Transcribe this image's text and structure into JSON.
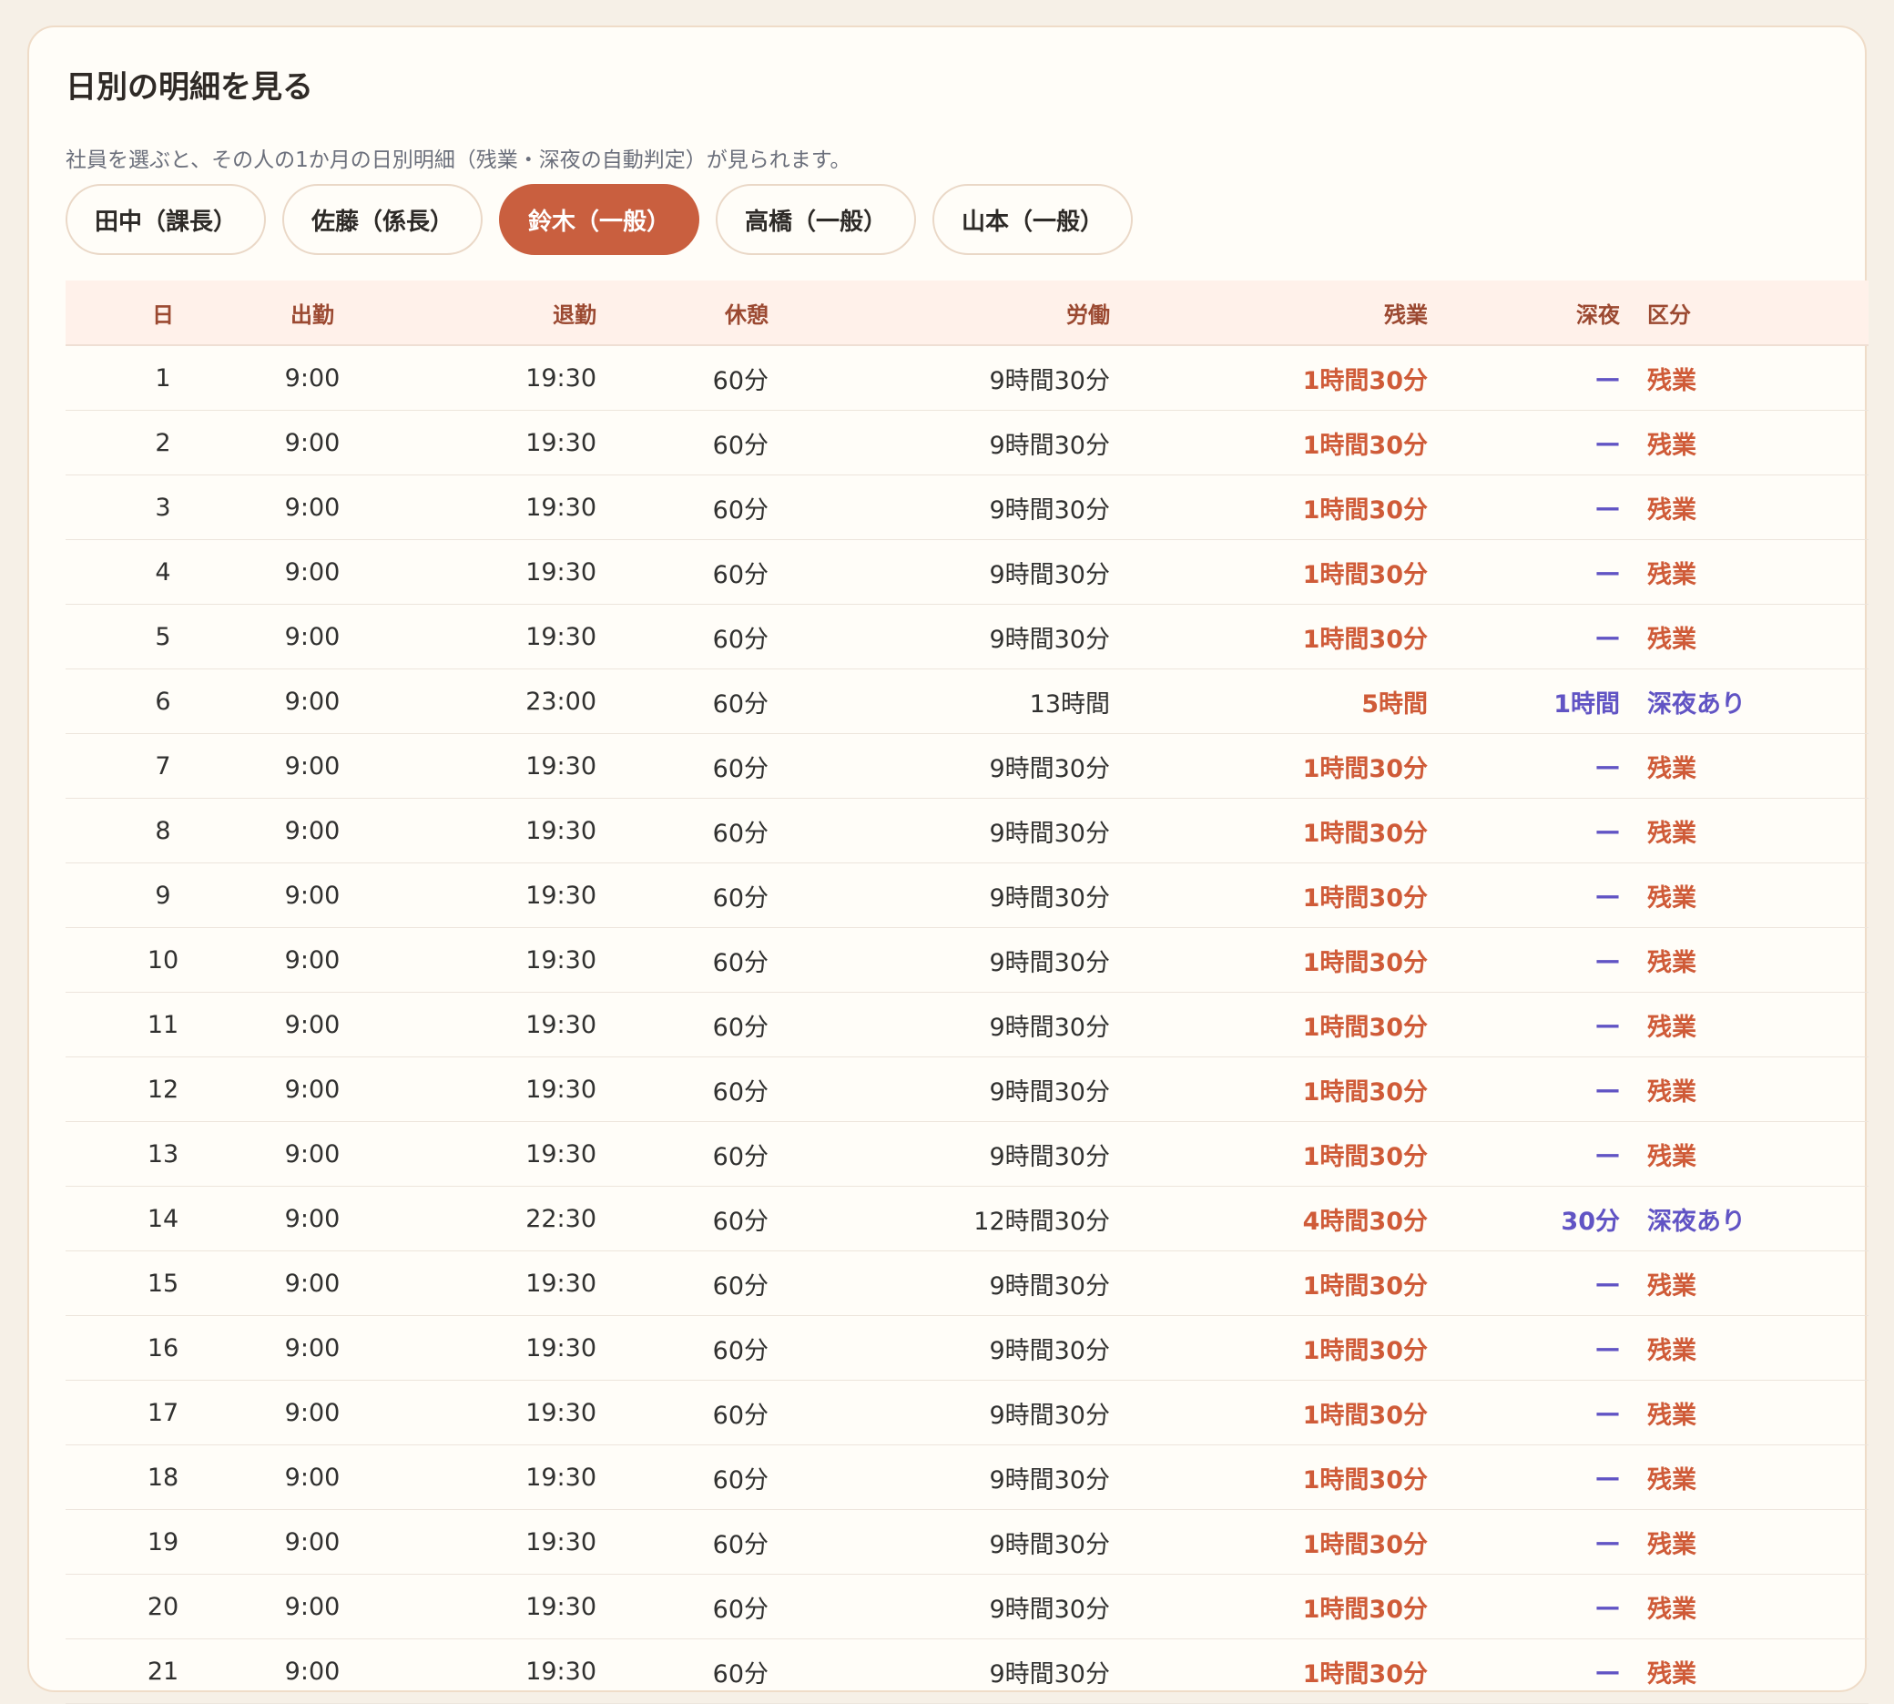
{
  "panel": {
    "title": "日別の明細を見る",
    "description": "社員を選ぶと、その人の1か月の日別明細（残業・深夜の自動判定）が見られます。"
  },
  "employees": [
    {
      "label": "田中（課長）",
      "selected": false
    },
    {
      "label": "佐藤（係長）",
      "selected": false
    },
    {
      "label": "鈴木（一般）",
      "selected": true
    },
    {
      "label": "高橋（一般）",
      "selected": false
    },
    {
      "label": "山本（一般）",
      "selected": false
    }
  ],
  "table": {
    "headers": [
      "日",
      "出勤",
      "退勤",
      "休憩",
      "労働",
      "残業",
      "深夜",
      "区分"
    ],
    "rows": [
      {
        "day": "1",
        "clock_in": "9:00",
        "clock_out": "19:30",
        "break": "60分",
        "work": "9時間30分",
        "overtime": "1時間30分",
        "night": "—",
        "category": "残業"
      },
      {
        "day": "2",
        "clock_in": "9:00",
        "clock_out": "19:30",
        "break": "60分",
        "work": "9時間30分",
        "overtime": "1時間30分",
        "night": "—",
        "category": "残業"
      },
      {
        "day": "3",
        "clock_in": "9:00",
        "clock_out": "19:30",
        "break": "60分",
        "work": "9時間30分",
        "overtime": "1時間30分",
        "night": "—",
        "category": "残業"
      },
      {
        "day": "4",
        "clock_in": "9:00",
        "clock_out": "19:30",
        "break": "60分",
        "work": "9時間30分",
        "overtime": "1時間30分",
        "night": "—",
        "category": "残業"
      },
      {
        "day": "5",
        "clock_in": "9:00",
        "clock_out": "19:30",
        "break": "60分",
        "work": "9時間30分",
        "overtime": "1時間30分",
        "night": "—",
        "category": "残業"
      },
      {
        "day": "6",
        "clock_in": "9:00",
        "clock_out": "23:00",
        "break": "60分",
        "work": "13時間",
        "overtime": "5時間",
        "night": "1時間",
        "category": "深夜あり"
      },
      {
        "day": "7",
        "clock_in": "9:00",
        "clock_out": "19:30",
        "break": "60分",
        "work": "9時間30分",
        "overtime": "1時間30分",
        "night": "—",
        "category": "残業"
      },
      {
        "day": "8",
        "clock_in": "9:00",
        "clock_out": "19:30",
        "break": "60分",
        "work": "9時間30分",
        "overtime": "1時間30分",
        "night": "—",
        "category": "残業"
      },
      {
        "day": "9",
        "clock_in": "9:00",
        "clock_out": "19:30",
        "break": "60分",
        "work": "9時間30分",
        "overtime": "1時間30分",
        "night": "—",
        "category": "残業"
      },
      {
        "day": "10",
        "clock_in": "9:00",
        "clock_out": "19:30",
        "break": "60分",
        "work": "9時間30分",
        "overtime": "1時間30分",
        "night": "—",
        "category": "残業"
      },
      {
        "day": "11",
        "clock_in": "9:00",
        "clock_out": "19:30",
        "break": "60分",
        "work": "9時間30分",
        "overtime": "1時間30分",
        "night": "—",
        "category": "残業"
      },
      {
        "day": "12",
        "clock_in": "9:00",
        "clock_out": "19:30",
        "break": "60分",
        "work": "9時間30分",
        "overtime": "1時間30分",
        "night": "—",
        "category": "残業"
      },
      {
        "day": "13",
        "clock_in": "9:00",
        "clock_out": "19:30",
        "break": "60分",
        "work": "9時間30分",
        "overtime": "1時間30分",
        "night": "—",
        "category": "残業"
      },
      {
        "day": "14",
        "clock_in": "9:00",
        "clock_out": "22:30",
        "break": "60分",
        "work": "12時間30分",
        "overtime": "4時間30分",
        "night": "30分",
        "category": "深夜あり"
      },
      {
        "day": "15",
        "clock_in": "9:00",
        "clock_out": "19:30",
        "break": "60分",
        "work": "9時間30分",
        "overtime": "1時間30分",
        "night": "—",
        "category": "残業"
      },
      {
        "day": "16",
        "clock_in": "9:00",
        "clock_out": "19:30",
        "break": "60分",
        "work": "9時間30分",
        "overtime": "1時間30分",
        "night": "—",
        "category": "残業"
      },
      {
        "day": "17",
        "clock_in": "9:00",
        "clock_out": "19:30",
        "break": "60分",
        "work": "9時間30分",
        "overtime": "1時間30分",
        "night": "—",
        "category": "残業"
      },
      {
        "day": "18",
        "clock_in": "9:00",
        "clock_out": "19:30",
        "break": "60分",
        "work": "9時間30分",
        "overtime": "1時間30分",
        "night": "—",
        "category": "残業"
      },
      {
        "day": "19",
        "clock_in": "9:00",
        "clock_out": "19:30",
        "break": "60分",
        "work": "9時間30分",
        "overtime": "1時間30分",
        "night": "—",
        "category": "残業"
      },
      {
        "day": "20",
        "clock_in": "9:00",
        "clock_out": "19:30",
        "break": "60分",
        "work": "9時間30分",
        "overtime": "1時間30分",
        "night": "—",
        "category": "残業"
      },
      {
        "day": "21",
        "clock_in": "9:00",
        "clock_out": "19:30",
        "break": "60分",
        "work": "9時間30分",
        "overtime": "1時間30分",
        "night": "—",
        "category": "残業"
      }
    ]
  },
  "colors": {
    "accent": "#c95f3f",
    "overtime": "#cf5b38",
    "night": "#6154c4",
    "header_bg": "#fff1ea"
  }
}
